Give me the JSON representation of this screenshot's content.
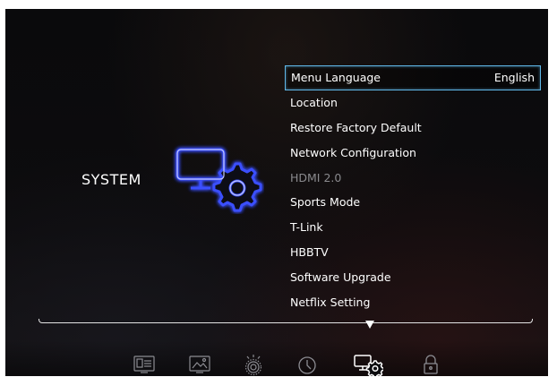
{
  "category": {
    "label": "SYSTEM"
  },
  "menu": {
    "items": [
      {
        "label": "Menu Language",
        "value": "English",
        "selected": true,
        "enabled": true
      },
      {
        "label": "Location",
        "value": "",
        "selected": false,
        "enabled": true
      },
      {
        "label": "Restore Factory Default",
        "value": "",
        "selected": false,
        "enabled": true
      },
      {
        "label": "Network Configuration",
        "value": "",
        "selected": false,
        "enabled": true
      },
      {
        "label": "HDMI 2.0",
        "value": "",
        "selected": false,
        "enabled": false
      },
      {
        "label": "Sports Mode",
        "value": "",
        "selected": false,
        "enabled": true
      },
      {
        "label": "T-Link",
        "value": "",
        "selected": false,
        "enabled": true
      },
      {
        "label": "HBBTV",
        "value": "",
        "selected": false,
        "enabled": true
      },
      {
        "label": "Software Upgrade",
        "value": "",
        "selected": false,
        "enabled": true
      },
      {
        "label": "Netflix Setting",
        "value": "",
        "selected": false,
        "enabled": true
      }
    ]
  },
  "bottom_tabs": [
    {
      "icon": "channel-icon",
      "active": false
    },
    {
      "icon": "picture-icon",
      "active": false
    },
    {
      "icon": "sound-icon",
      "active": false
    },
    {
      "icon": "clock-icon",
      "active": false
    },
    {
      "icon": "system-icon",
      "active": true
    },
    {
      "icon": "lock-icon",
      "active": false
    }
  ],
  "colors": {
    "selection_border": "#5fb7e8",
    "system_icon_glow": "#3b50ff",
    "text": "#ffffff",
    "disabled_text": "#8a8a8e"
  }
}
